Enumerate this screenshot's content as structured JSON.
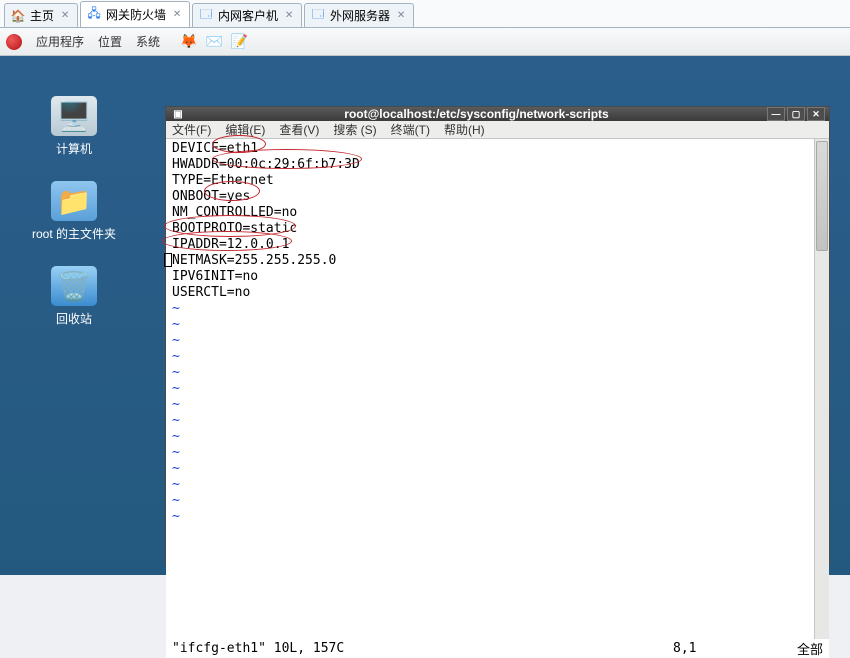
{
  "host_tabs": [
    {
      "icon": "🏠",
      "label": "主页"
    },
    {
      "icon": "🖧",
      "label": "网关防火墙"
    },
    {
      "icon": "🗔",
      "label": "内网客户机"
    },
    {
      "icon": "🗔",
      "label": "外网服务器"
    }
  ],
  "gnome": {
    "apps": "应用程序",
    "places": "位置",
    "system": "系统"
  },
  "desktop": {
    "computer": "计算机",
    "home": "root 的主文件夹",
    "trash": "回收站"
  },
  "terminal": {
    "title": "root@localhost:/etc/sysconfig/network-scripts",
    "menu": {
      "file": "文件(F)",
      "edit": "编辑(E)",
      "view": "查看(V)",
      "search": "搜索 (S)",
      "terminal": "终端(T)",
      "help": "帮助(H)"
    },
    "lines": [
      "DEVICE=eth1",
      "HWADDR=00:0c:29:6f:b7:3D",
      "TYPE=Ethernet",
      "ONBOOT=yes",
      "NM_CONTROLLED=no",
      "BOOTPROTO=static",
      "IPADDR=12.0.0.1",
      "NETMASK=255.255.255.0",
      "IPV6INIT=no",
      "USERCTL=no"
    ],
    "status": {
      "file": "\"ifcfg-eth1\" 10L, 157C",
      "pos": "8,1",
      "pct": "全部"
    }
  }
}
